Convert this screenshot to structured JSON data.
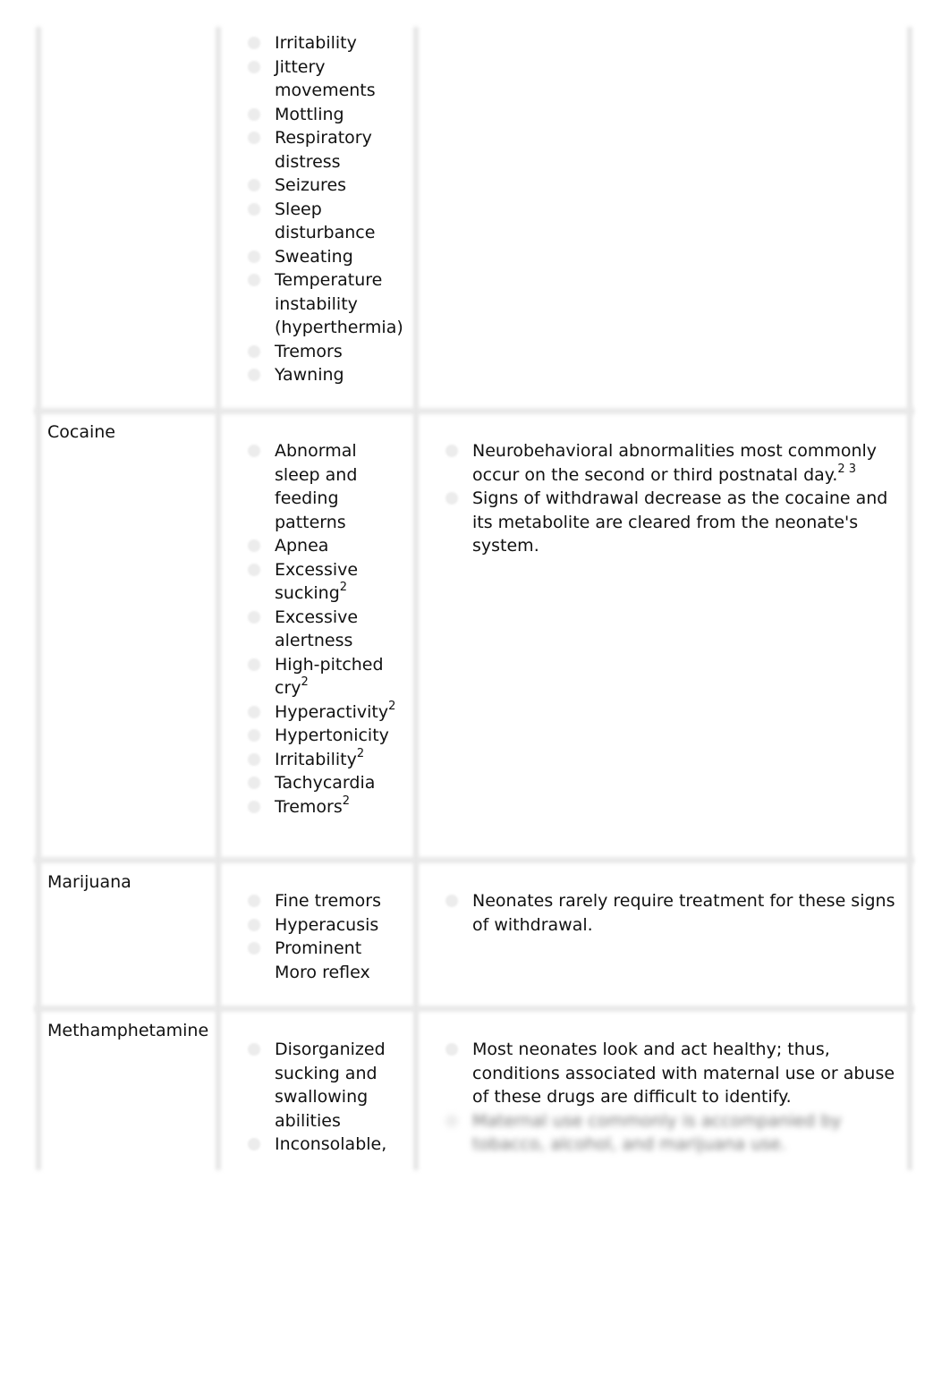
{
  "rows": [
    {
      "drug": "",
      "signs": [
        {
          "text": "Irritability"
        },
        {
          "text": "Jittery movements"
        },
        {
          "text": "Mottling"
        },
        {
          "text": "Respiratory distress"
        },
        {
          "text": "Seizures"
        },
        {
          "text": "Sleep disturbance"
        },
        {
          "text": "Sweating"
        },
        {
          "text": "Temperature instability (hyperthermia)"
        },
        {
          "text": "Tremors"
        },
        {
          "text": "Yawning"
        }
      ],
      "notes": []
    },
    {
      "drug": "Cocaine",
      "signs": [
        {
          "text": "Abnormal sleep and feeding patterns"
        },
        {
          "text": "Apnea"
        },
        {
          "text": "Excessive sucking",
          "sup": "2"
        },
        {
          "text": "Excessive alertness"
        },
        {
          "text": "High-pitched cry",
          "sup": "2"
        },
        {
          "text": "Hyperactivity",
          "sup": "2"
        },
        {
          "text": "Hypertonicity"
        },
        {
          "text": "Irritability",
          "sup": "2"
        },
        {
          "text": "Tachycardia"
        },
        {
          "text": "Tremors",
          "sup": "2"
        }
      ],
      "notes": [
        {
          "text": "Neurobehavioral abnormalities most commonly occur on the second or third postnatal day.",
          "sup": "2 3"
        },
        {
          "text": "Signs of withdrawal decrease as the cocaine and its metabolite are cleared from the neonate's system."
        }
      ]
    },
    {
      "drug": "Marijuana",
      "signs": [
        {
          "text": "Fine tremors"
        },
        {
          "text": "Hyperacusis"
        },
        {
          "text": "Prominent Moro reflex"
        }
      ],
      "notes": [
        {
          "text": "Neonates rarely require treatment for these signs of withdrawal."
        }
      ]
    },
    {
      "drug": "Methamphetamine",
      "signs": [
        {
          "text": "Disorganized sucking and swallowing abilities"
        },
        {
          "text": "Inconsolable,"
        }
      ],
      "notes": [
        {
          "text": "Most neonates look and act healthy; thus, conditions associated with maternal use or abuse of these drugs are difficult to identify."
        },
        {
          "text": "Maternal use commonly is accompanied by tobacco, alcohol, and marijuana use.",
          "blurred": true
        }
      ]
    }
  ]
}
